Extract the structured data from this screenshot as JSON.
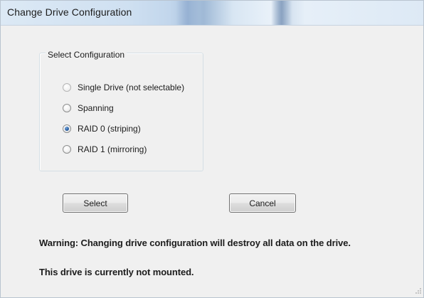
{
  "window": {
    "title": "Change  Drive Configuration"
  },
  "config_group": {
    "legend": "Select  Configuration",
    "options": [
      {
        "label": "Single Drive (not selectable)",
        "checked": false,
        "disabled": true
      },
      {
        "label": "Spanning",
        "checked": false,
        "disabled": false
      },
      {
        "label": "RAID 0 (striping)",
        "checked": true,
        "disabled": false
      },
      {
        "label": "RAID 1 (mirroring)",
        "checked": false,
        "disabled": false
      }
    ]
  },
  "buttons": {
    "select_label": "Select",
    "cancel_label": "Cancel"
  },
  "messages": {
    "warning": "Warning: Changing drive configuration will destroy all data on the drive.",
    "status": "This drive is currently not mounted."
  },
  "colors": {
    "title_bar": "#dce9f5",
    "dialog_background": "#f0f0f0",
    "radio_selected": "#2e64a8"
  }
}
